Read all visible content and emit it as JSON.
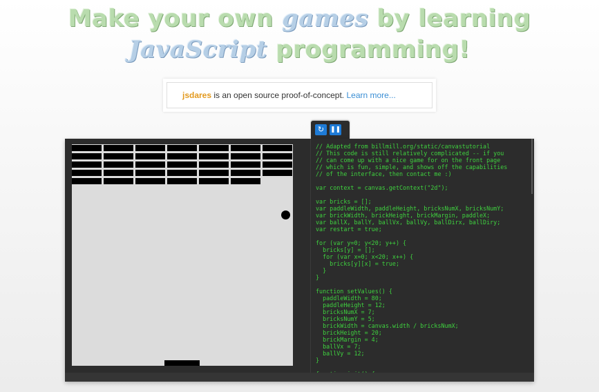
{
  "headline": {
    "line1_a": "Make your own",
    "line1_em": "games",
    "line1_b": "by learning",
    "line2_em": "JavaScript",
    "line2_b": "programming!"
  },
  "intro": {
    "brand": "jsdares",
    "text": " is an open source proof-of-concept. ",
    "link": "Learn more..."
  },
  "toolbar": {
    "restart_icon": "↻",
    "pause_icon": "❚❚"
  },
  "game": {
    "bricks_per_row": [
      7,
      7,
      7,
      7,
      6
    ]
  },
  "code_lines": [
    "// Adapted from billmill.org/static/canvastutorial",
    "// This code is still relatively complicated -- if you",
    "// can come up with a nice game for on the front page",
    "// which is fun, simple, and shows off the capabilities",
    "// of the interface, then contact me :)",
    "",
    "var context = canvas.getContext(\"2d\");",
    "",
    "var bricks = [];",
    "var paddleWidth, paddleHeight, bricksNumX, bricksNumY;",
    "var brickWidth, brickHeight, brickMargin, paddleX;",
    "var ballX, ballY, ballVx, ballVy, ballDirx, ballDiry;",
    "var restart = true;",
    "",
    "for (var y=0; y<20; y++) {",
    "  bricks[y] = [];",
    "  for (var x=0; x<20; x++) {",
    "    bricks[y][x] = true;",
    "  }",
    "}",
    "",
    "function setValues() {",
    "  paddleWidth = 80;",
    "  paddleHeight = 12;",
    "  bricksNumX = 7;",
    "  bricksNumY = 5;",
    "  brickWidth = canvas.width / bricksNumX;",
    "  brickHeight = 20;",
    "  brickMargin = 4;",
    "  ballVx = 7;",
    "  ballVy = 12;",
    "}",
    "",
    "function init() {"
  ]
}
